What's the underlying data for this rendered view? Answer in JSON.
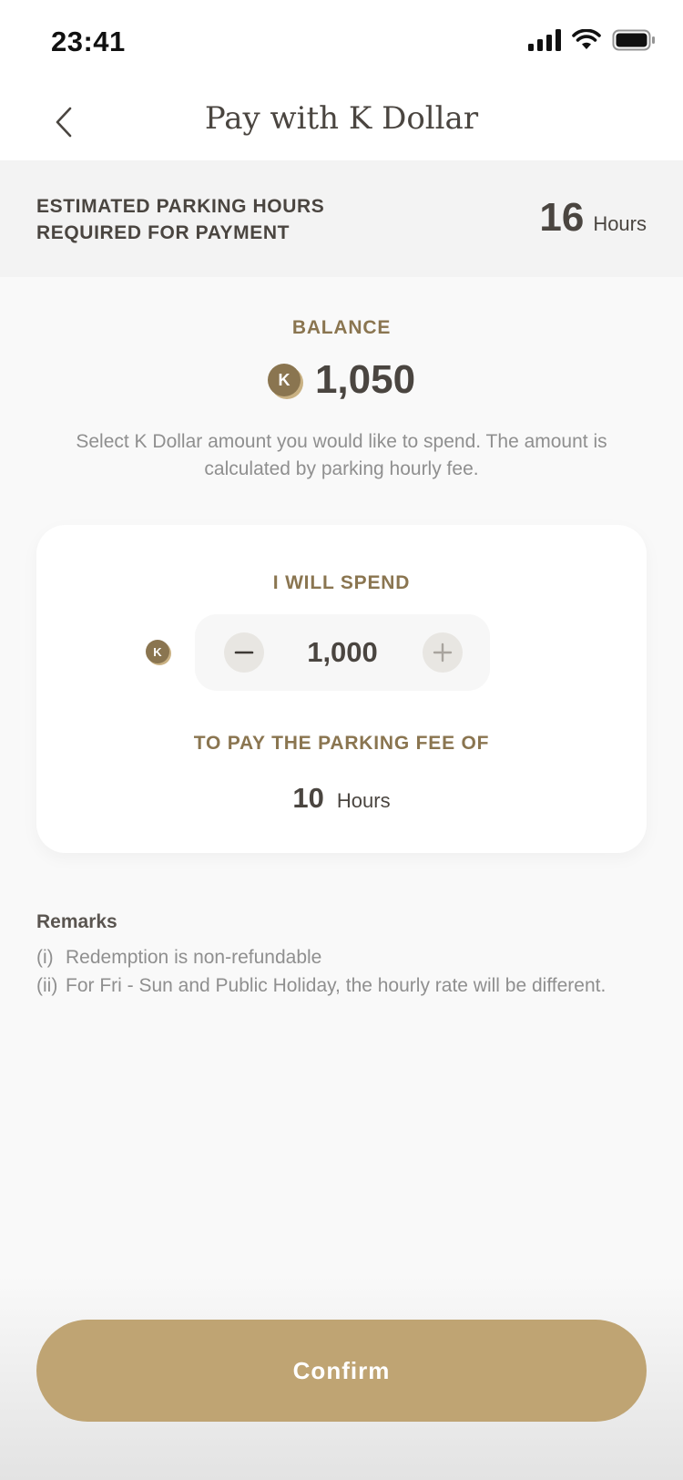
{
  "status_bar": {
    "time": "23:41"
  },
  "nav": {
    "title": "Pay with K Dollar"
  },
  "estimate": {
    "label": "ESTIMATED PARKING HOURS REQUIRED FOR PAYMENT",
    "value": "16",
    "unit": "Hours"
  },
  "balance": {
    "label": "BALANCE",
    "coin_letter": "K",
    "amount": "1,050",
    "description": "Select K Dollar amount you would like to spend. The amount is calculated by parking hourly fee."
  },
  "spend": {
    "title": "I WILL SPEND",
    "coin_letter": "K",
    "value": "1,000",
    "fee_label": "TO PAY THE PARKING FEE OF",
    "fee_value": "10",
    "fee_unit": "Hours"
  },
  "remarks": {
    "title": "Remarks",
    "items": [
      {
        "index": "(i)",
        "text": "Redemption is non-refundable"
      },
      {
        "index": "(ii)",
        "text": "For Fri - Sun and Public Holiday, the hourly rate will be different."
      }
    ]
  },
  "confirm": {
    "label": "Confirm"
  },
  "colors": {
    "accent": "#8a7550",
    "button": "#bfa473",
    "text": "#4a4540",
    "muted": "#8f8f8f"
  },
  "icons": {
    "back": "chevron-left-icon",
    "signal": "cellular-signal-icon",
    "wifi": "wifi-icon",
    "battery": "battery-icon",
    "minus": "minus-icon",
    "plus": "plus-icon"
  }
}
